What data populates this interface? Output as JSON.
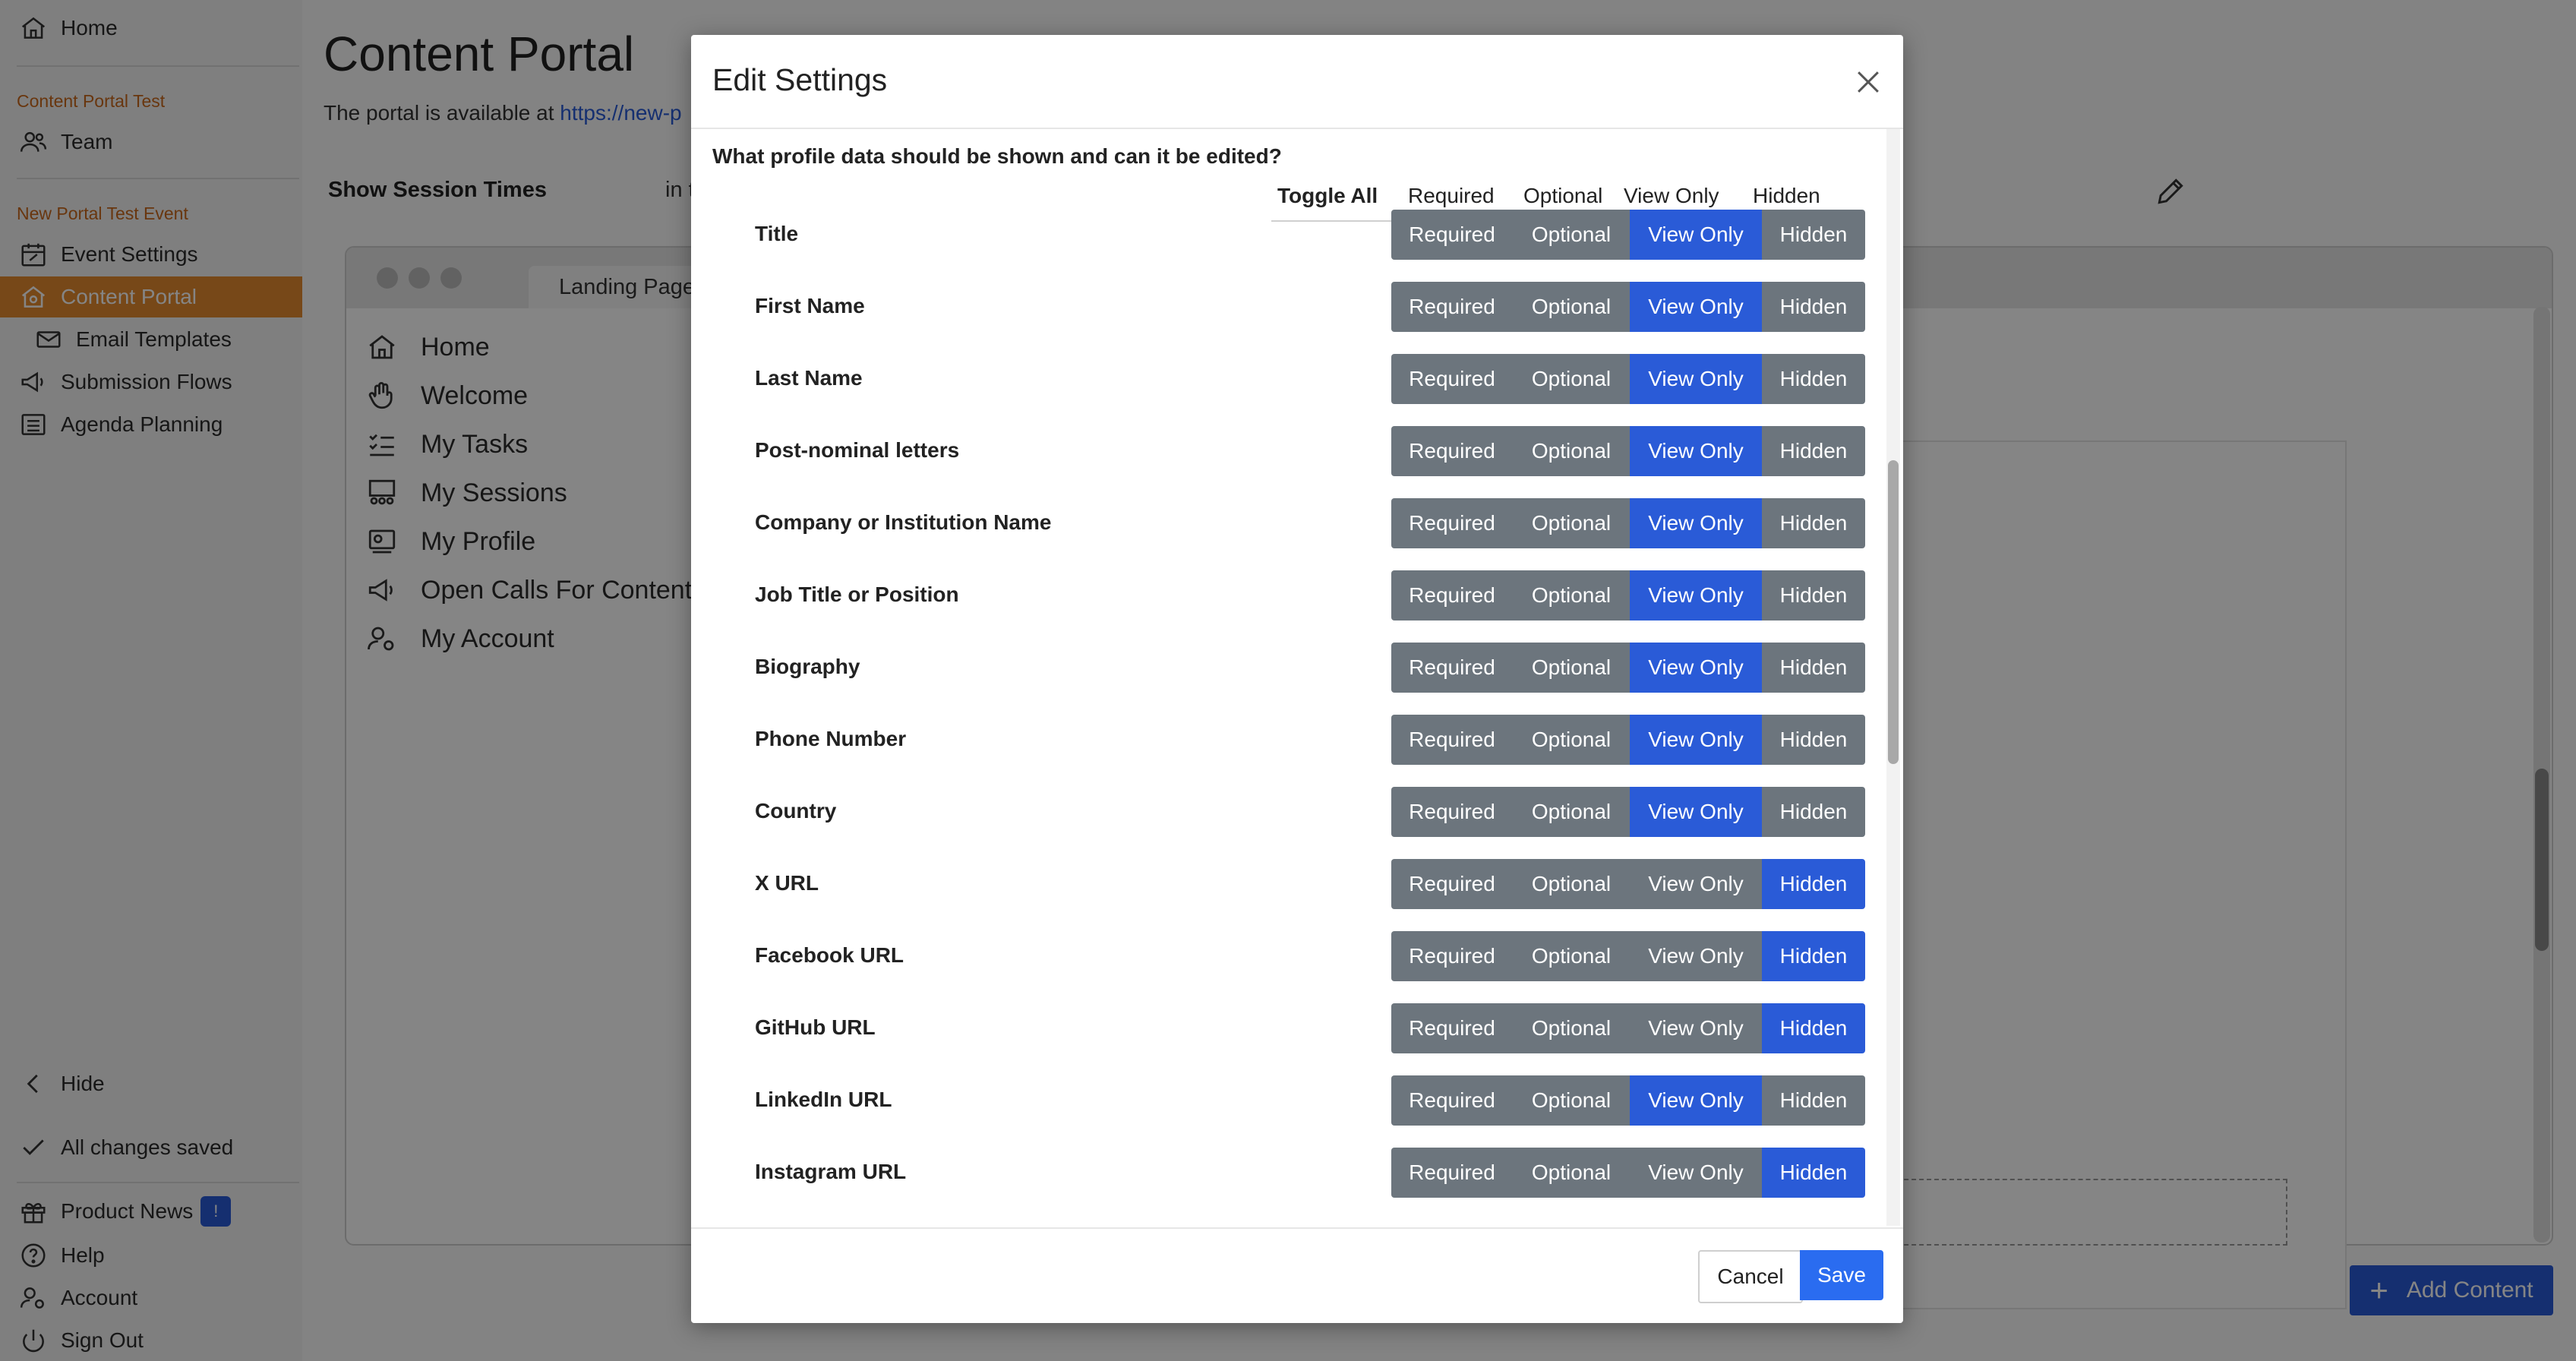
{
  "sidebar": {
    "home": "Home",
    "section1": "Content Portal Test",
    "team": "Team",
    "section2": "New Portal Test Event",
    "event_settings": "Event Settings",
    "content_portal": "Content Portal",
    "email_templates": "Email Templates",
    "submission_flows": "Submission Flows",
    "agenda_planning": "Agenda Planning",
    "hide": "Hide",
    "saved": "All changes saved",
    "product_news": "Product News",
    "news_badge": "!",
    "help": "Help",
    "account": "Account",
    "sign_out": "Sign Out"
  },
  "main": {
    "title": "Content Portal",
    "portal_text": "The portal is available at",
    "portal_link": "https://new-p",
    "session_label": "Show Session Times",
    "session_tail": "in t",
    "landing_tab": "Landing Page",
    "nav": [
      "Home",
      "Welcome",
      "My Tasks",
      "My Sessions",
      "My Profile",
      "Open Calls For Content",
      "My Account"
    ],
    "add_content": "Add Content"
  },
  "modal": {
    "title": "Edit Settings",
    "question": "What profile data should be shown and can it be edited?",
    "toggle_all": "Toggle All",
    "options": [
      "Required",
      "Optional",
      "View Only",
      "Hidden"
    ],
    "fields": [
      {
        "label": "Title",
        "selected": "View Only"
      },
      {
        "label": "First Name",
        "selected": "View Only"
      },
      {
        "label": "Last Name",
        "selected": "View Only"
      },
      {
        "label": "Post-nominal letters",
        "selected": "View Only"
      },
      {
        "label": "Company or Institution Name",
        "selected": "View Only"
      },
      {
        "label": "Job Title or Position",
        "selected": "View Only"
      },
      {
        "label": "Biography",
        "selected": "View Only"
      },
      {
        "label": "Phone Number",
        "selected": "View Only"
      },
      {
        "label": "Country",
        "selected": "View Only"
      },
      {
        "label": "X URL",
        "selected": "Hidden"
      },
      {
        "label": "Facebook URL",
        "selected": "Hidden"
      },
      {
        "label": "GitHub URL",
        "selected": "Hidden"
      },
      {
        "label": "LinkedIn URL",
        "selected": "View Only"
      },
      {
        "label": "Instagram URL",
        "selected": "Hidden"
      }
    ],
    "cancel": "Cancel",
    "save": "Save"
  },
  "colors": {
    "accent": "#e58a2e",
    "primary": "#2a5bd7",
    "segment_default": "#6c757d"
  }
}
